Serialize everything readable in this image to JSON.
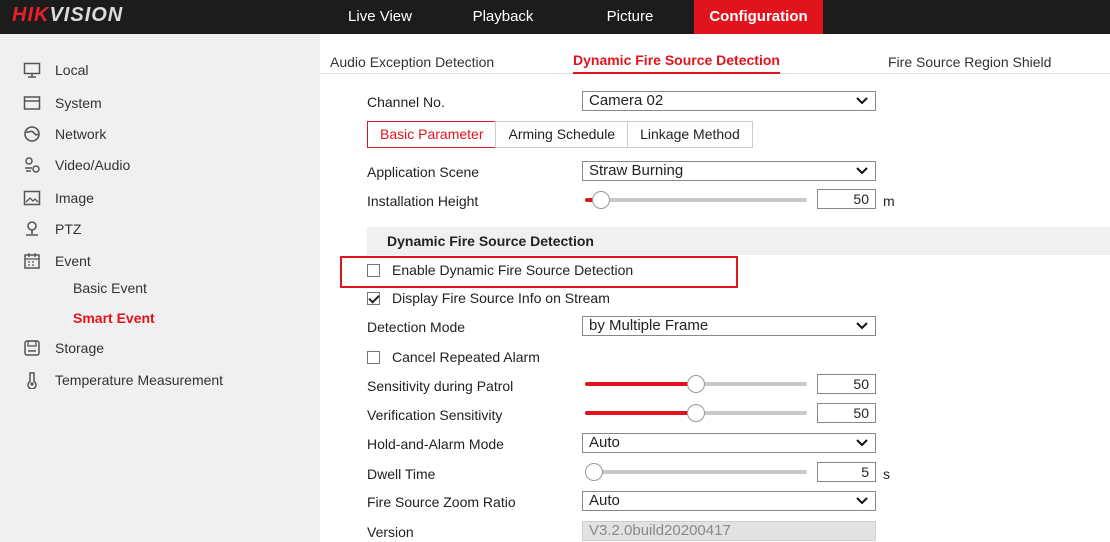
{
  "header": {
    "logo_hik": "HIK",
    "logo_vision": "VISION",
    "nav": [
      {
        "label": "Live View",
        "active": false
      },
      {
        "label": "Playback",
        "active": false
      },
      {
        "label": "Picture",
        "active": false
      },
      {
        "label": "Configuration",
        "active": true
      }
    ]
  },
  "sidebar": {
    "items": [
      {
        "label": "Local",
        "icon": "monitor-icon"
      },
      {
        "label": "System",
        "icon": "system-icon"
      },
      {
        "label": "Network",
        "icon": "globe-icon"
      },
      {
        "label": "Video/Audio",
        "icon": "video-audio-icon"
      },
      {
        "label": "Image",
        "icon": "image-icon"
      },
      {
        "label": "PTZ",
        "icon": "ptz-icon"
      },
      {
        "label": "Event",
        "icon": "calendar-icon"
      }
    ],
    "sub_items": [
      {
        "label": "Basic Event",
        "active": false
      },
      {
        "label": "Smart Event",
        "active": true
      }
    ],
    "more_items": [
      {
        "label": "Storage",
        "icon": "storage-icon"
      },
      {
        "label": "Temperature Measurement",
        "icon": "thermometer-icon"
      }
    ]
  },
  "tabs": [
    {
      "label": "Audio Exception Detection",
      "active": false
    },
    {
      "label": "Dynamic Fire Source Detection",
      "active": true
    },
    {
      "label": "Fire Source Region Shield",
      "active": false
    }
  ],
  "channel": {
    "label": "Channel No.",
    "value": "Camera 02"
  },
  "subtabs": [
    {
      "label": "Basic Parameter",
      "active": true
    },
    {
      "label": "Arming Schedule",
      "active": false
    },
    {
      "label": "Linkage Method",
      "active": false
    }
  ],
  "application_scene": {
    "label": "Application Scene",
    "value": "Straw Burning"
  },
  "installation_height": {
    "label": "Installation Height",
    "value": "50",
    "unit": "m",
    "level": 0.07
  },
  "section_title": "Dynamic Fire Source Detection",
  "enable_detection": {
    "label": "Enable Dynamic Fire Source Detection",
    "checked": false
  },
  "display_info": {
    "label": "Display Fire Source Info on Stream",
    "checked": true
  },
  "detection_mode": {
    "label": "Detection Mode",
    "value": "by Multiple Frame"
  },
  "cancel_repeated": {
    "label": "Cancel Repeated Alarm",
    "checked": false
  },
  "sensitivity_patrol": {
    "label": "Sensitivity during Patrol",
    "value": "50",
    "level": 0.5
  },
  "verification_sensitivity": {
    "label": "Verification Sensitivity",
    "value": "50",
    "level": 0.5
  },
  "hold_alarm_mode": {
    "label": "Hold-and-Alarm Mode",
    "value": "Auto"
  },
  "dwell_time": {
    "label": "Dwell Time",
    "value": "5",
    "unit": "s",
    "level": 0.04
  },
  "zoom_ratio": {
    "label": "Fire Source Zoom Ratio",
    "value": "Auto"
  },
  "version": {
    "label": "Version",
    "value": "V3.2.0build20200417"
  },
  "colors": {
    "accent": "#e1141e",
    "topbar": "#1c1c1c",
    "sidebar": "#f0f0f0"
  }
}
